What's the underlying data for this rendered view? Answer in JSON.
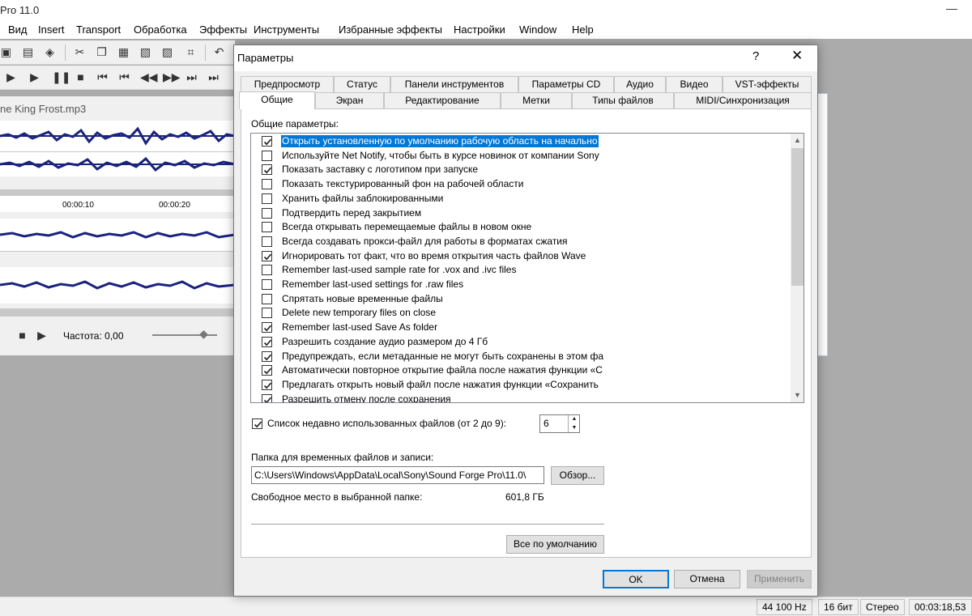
{
  "app": {
    "title": "Pro 11.0",
    "document_title": "ne King Frost.mp3"
  },
  "menu": [
    "Вид",
    "Insert",
    "Transport",
    "Обработка",
    "Эффекты",
    "Инструменты",
    "Избранные эффекты",
    "Настройки",
    "Window",
    "Help"
  ],
  "ruler": {
    "mark1": "00:00:10",
    "mark2": "00:00:20"
  },
  "transport_bar": {
    "frequency_label": "Частота: 0,00"
  },
  "statusbar": {
    "sample_rate": "44 100 Hz",
    "bit_depth": "16 бит",
    "channels": "Стерео",
    "length": "00:03:18,53"
  },
  "dialog": {
    "title": "Параметры",
    "help_glyph": "?",
    "close_glyph": "✕",
    "tabs_back_row": [
      "Предпросмотр",
      "Статус",
      "Панели инструментов",
      "Параметры CD",
      "Аудио",
      "Видео",
      "VST-эффекты"
    ],
    "tabs_front_row": [
      "Общие",
      "Экран",
      "Редактирование",
      "Метки",
      "Типы файлов",
      "MIDI/Синхронизация"
    ],
    "active_tab": "Общие",
    "general": {
      "group_label": "Общие параметры:",
      "options": [
        {
          "label": "Открыть установленную по умолчанию рабочую область на начально",
          "checked": true,
          "selected": true
        },
        {
          "label": "Используйте Net Notify, чтобы быть в курсе новинок от компании Sony",
          "checked": false
        },
        {
          "label": "Показать заставку с логотипом при запуске",
          "checked": true
        },
        {
          "label": "Показать текстурированный фон на рабочей области",
          "checked": false
        },
        {
          "label": "Хранить файлы заблокированными",
          "checked": false
        },
        {
          "label": "Подтвердить перед закрытием",
          "checked": false
        },
        {
          "label": "Всегда открывать перемещаемые файлы в новом окне",
          "checked": false
        },
        {
          "label": "Всегда создавать прокси-файл для работы в форматах сжатия",
          "checked": false
        },
        {
          "label": "Игнорировать тот факт, что  во время открытия часть  файлов Wave",
          "checked": true
        },
        {
          "label": "Remember last-used sample rate for .vox and .ivc files",
          "checked": false
        },
        {
          "label": "Remember last-used settings for .raw files",
          "checked": false
        },
        {
          "label": "Спрятать новые временные файлы",
          "checked": false
        },
        {
          "label": "Delete new temporary files on close",
          "checked": false
        },
        {
          "label": "Remember last-used Save As folder",
          "checked": true
        },
        {
          "label": "Разрешить создание аудио размером до 4 Гб",
          "checked": true
        },
        {
          "label": "Предупреждать, если метаданные не могут быть сохранены в этом фа",
          "checked": true
        },
        {
          "label": "Автоматически повторное открытие файла после нажатия функции «С",
          "checked": true
        },
        {
          "label": "Предлагать открыть новый файл после нажатия функции «Сохранить",
          "checked": true
        },
        {
          "label": "Разрешить отмену после сохранения",
          "checked": true
        }
      ],
      "recent_files": {
        "label": "Список недавно использованных файлов (от 2 до 9):",
        "checked": true,
        "value": "6"
      },
      "temp_folder": {
        "label": "Папка для временных файлов и записи:",
        "value": "C:\\Users\\Windows\\AppData\\Local\\Sony\\Sound Forge Pro\\11.0\\",
        "browse_label": "Обзор..."
      },
      "free_space": {
        "label": "Свободное место в выбранной папке:",
        "value": "601,8 ГБ"
      },
      "defaults_label": "Все по умолчанию"
    },
    "buttons": {
      "ok": "OK",
      "cancel": "Отмена",
      "apply": "Применить"
    }
  }
}
